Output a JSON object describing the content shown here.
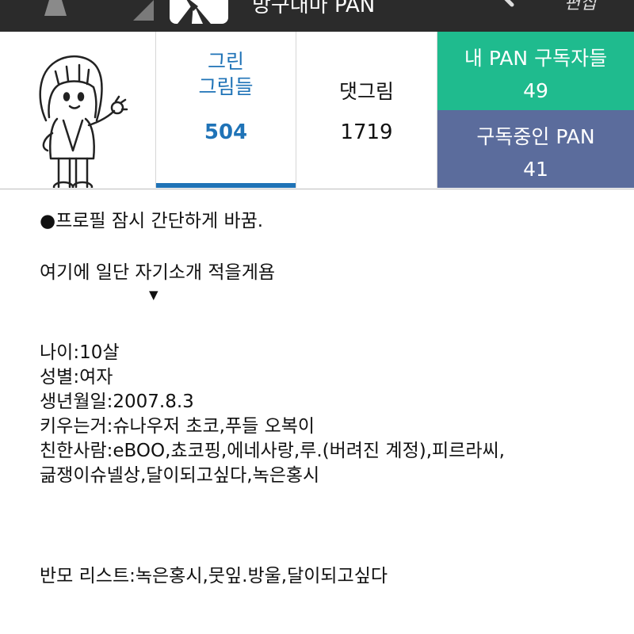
{
  "top_bar": {
    "title": "방구대마 PAN",
    "right_text": "편집",
    "background": "#2b2b2b"
  },
  "stats": {
    "drawn": {
      "label": "그린\n그림들",
      "line1": "그린",
      "line2": "그림들",
      "count": "504",
      "color": "#1f73b7",
      "selected": true
    },
    "replies": {
      "label": "댓그림",
      "count": "1719"
    },
    "my_subscribers": {
      "label": "내 PAN 구독자들",
      "count": "49",
      "color": "#1fbb8e"
    },
    "subscribing": {
      "label": "구독중인 PAN",
      "count": "41",
      "color": "#5b6c9c"
    }
  },
  "bio": {
    "line_notice": "●프로필 잠시 간단하게 바꿈.",
    "line_intro": "여기에 일단 자기소개 적을게욤",
    "arrow": "▼",
    "line_age": "나이:10살",
    "line_gender": "성별:여자",
    "line_birth": "생년월일:2007.8.3",
    "line_pets": "키우는거:슈나우저 초코,푸들 오복이",
    "line_friends_1": "친한사람:eBOO,쵸코핑,에네사랑,루.(버려진 계정),피르라씨,",
    "line_friends_2": "긂쟁이슈넬상,달이되고싶다,녹은홍시",
    "line_banmo": "반모 리스트:녹은홍시,뭇잎.방울,달이되고싶다"
  }
}
